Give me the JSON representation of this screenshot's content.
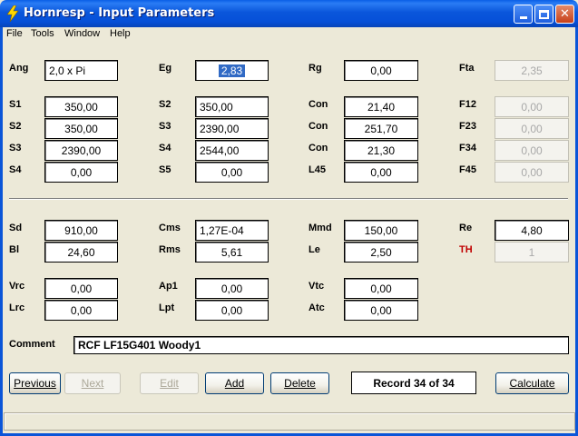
{
  "window": {
    "title": "Hornresp - Input Parameters"
  },
  "menu": [
    "File",
    "Tools",
    "Window",
    "Help"
  ],
  "labels": {
    "ang": "Ang",
    "eg": "Eg",
    "rg": "Rg",
    "fta": "Fta",
    "s1": "S1",
    "s2": "S2",
    "s3": "S3",
    "s4": "S4",
    "s5": "S5",
    "con": "Con",
    "l45": "L45",
    "f12": "F12",
    "f23": "F23",
    "f34": "F34",
    "f45": "F45",
    "sd": "Sd",
    "bl": "Bl",
    "cms": "Cms",
    "rms": "Rms",
    "mmd": "Mmd",
    "le": "Le",
    "re": "Re",
    "th": "TH",
    "vrc": "Vrc",
    "lrc": "Lrc",
    "ap1": "Ap1",
    "lpt": "Lpt",
    "vtc": "Vtc",
    "atc": "Atc",
    "comment": "Comment"
  },
  "values": {
    "ang": "2,0 x Pi",
    "eg": "2,83",
    "rg": "0,00",
    "fta": "2,35",
    "s1_a": "350,00",
    "s2_a": "350,00",
    "s3_a": "2390,00",
    "s4_a": "0,00",
    "s2_b": "350,00",
    "s3_b": "2390,00",
    "s4_b": "2544,00",
    "s5_b": "0,00",
    "con1": "21,40",
    "con2": "251,70",
    "con3": "21,30",
    "l45": "0,00",
    "f12": "0,00",
    "f23": "0,00",
    "f34": "0,00",
    "f45": "0,00",
    "sd": "910,00",
    "bl": "24,60",
    "cms": "1,27E-04",
    "rms": "5,61",
    "mmd": "150,00",
    "le": "2,50",
    "re": "4,80",
    "th": "1",
    "vrc": "0,00",
    "lrc": "0,00",
    "ap1": "0,00",
    "lpt": "0,00",
    "vtc": "0,00",
    "atc": "0,00",
    "comment": "RCF LF15G401 Woody1"
  },
  "buttons": {
    "previous": "Previous",
    "next": "Next",
    "edit": "Edit",
    "add": "Add",
    "delete": "Delete",
    "calculate": "Calculate"
  },
  "record": "Record 34 of 34",
  "colors": {
    "title_blue": "#0a56db",
    "th_red": "#c00000",
    "selection": "#316ac5"
  }
}
